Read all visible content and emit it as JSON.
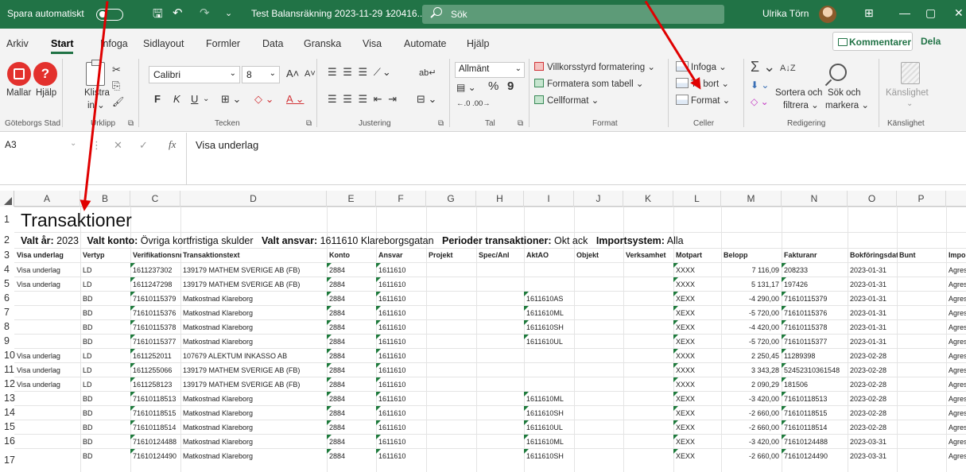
{
  "titlebar": {
    "autosave_label": "Spara automatiskt",
    "toggle_state": "På",
    "document_title": "Test Balansräkning 2023-11-29 120416....",
    "caret": "⌄",
    "search_label": "Sök",
    "user_name": "Ulrika Törn",
    "save_glyph": "🖫",
    "undo_glyph": "↶",
    "redo_glyph": "↷",
    "qat_glyph": "⌄",
    "win_restore_glyph": "⊞",
    "win_min_glyph": "—",
    "win_max_glyph": "▢",
    "win_close_glyph": "✕"
  },
  "tabs": [
    "Arkiv",
    "Start",
    "Infoga",
    "Sidlayout",
    "Formler",
    "Data",
    "Granska",
    "Visa",
    "Automate",
    "Hjälp"
  ],
  "active_tab": "Start",
  "tab_actions": {
    "comments": "Kommentarer",
    "share": "Dela"
  },
  "ribbon": {
    "goteborg": {
      "mallar": "Mallar",
      "hjalp": "Hjälp",
      "label": "Göteborgs Stad"
    },
    "clipboard": {
      "paste_1": "Klistra",
      "paste_2": "in ⌄",
      "label": "Urklipp",
      "cut": "✂",
      "copy": "⎘",
      "brush": "🖌",
      "launcher": "⧉"
    },
    "font": {
      "name": "Calibri",
      "size": "8",
      "grow": "A˄",
      "shrink": "A˅",
      "bold": "F",
      "italic": "K",
      "underline": "U",
      "underline_caret": "⌄",
      "borders": "⊞ ⌄",
      "fill": "◇ ⌄",
      "color": "A ⌄",
      "label": "Tecken",
      "font_caret": "⌄",
      "size_caret": "⌄",
      "launcher": "⧉"
    },
    "alignment": {
      "top_row": "☰ ☰ ☰ ⟋⌄",
      "bottom_row": "☰ ☰ ☰ ⇤ ⇥",
      "wrap": "ab↵",
      "merge": "⊟ ⌄",
      "label": "Justering",
      "launcher": "⧉"
    },
    "number": {
      "format": "Allmänt",
      "format_caret": "⌄",
      "currency": "▤ ⌄",
      "percent": "%",
      "comma": "9",
      "decimals": "←.0 .00→",
      "label": "Tal",
      "launcher": "⧉"
    },
    "styles": {
      "cond": "Villkorsstyrd formatering ⌄",
      "table": "Formatera som tabell ⌄",
      "cell": "Cellformat ⌄",
      "label": "Format"
    },
    "cells": {
      "insert": "Infoga ⌄",
      "delete": "Ta bort ⌄",
      "format": "Format ⌄",
      "label": "Celler"
    },
    "editing": {
      "autosum": "Σ ⌄",
      "fill": "⬇ ⌄",
      "clear": "◇ ⌄",
      "sort_1": "Sortera och",
      "sort_2": "filtrera ⌄",
      "find_1": "Sök och",
      "find_2": "markera ⌄",
      "label": "Redigering",
      "sort_glyph": "A↓Z"
    },
    "sensitivity": {
      "btn": "Känslighet",
      "caret": "⌄",
      "label": "Känslighet"
    }
  },
  "formula_bar": {
    "name_box": "A3",
    "name_caret": "⌄",
    "dots": "⋮",
    "cancel": "✕",
    "enter": "✓",
    "fx": "fx",
    "value": "Visa underlag"
  },
  "columns": [
    "A",
    "B",
    "C",
    "D",
    "E",
    "F",
    "G",
    "H",
    "I",
    "J",
    "K",
    "L",
    "M",
    "N",
    "O",
    "P"
  ],
  "row_numbers": [
    "1",
    "2",
    "3",
    "4",
    "5",
    "6",
    "7",
    "8",
    "9",
    "10",
    "11",
    "12",
    "13",
    "14",
    "15",
    "16",
    "17"
  ],
  "sheet": {
    "title": "Transaktioner",
    "info": [
      {
        "label": "Valt år:",
        "value": "2023"
      },
      {
        "label": "Valt konto:",
        "value": "Övriga kortfristiga skulder"
      },
      {
        "label": "Valt ansvar:",
        "value": "1611610 Klareborgsgatan"
      },
      {
        "label": "Perioder transaktioner:",
        "value": "Okt ack"
      },
      {
        "label": "Importsystem:",
        "value": "Alla"
      }
    ],
    "headers": [
      "Visa underlag",
      "Vertyp",
      "Verifikationsnr",
      "Transaktionstext",
      "Konto",
      "Ansvar",
      "Projekt",
      "Spec/Anl",
      "AktAO",
      "Objekt",
      "Verksamhet",
      "Motpart",
      "Belopp",
      "Fakturanr",
      "Bokföringsdat",
      "Bunt",
      "Impo"
    ],
    "rows": [
      [
        "Visa underlag",
        "LD",
        "1611237302",
        "139179 MATHEM SVERIGE AB (FB)",
        "2884",
        "1611610",
        "",
        "",
        "",
        "",
        "",
        "XXXX",
        "7 116,09",
        "208233",
        "2023-01-31",
        "",
        "Agres"
      ],
      [
        "Visa underlag",
        "LD",
        "1611247298",
        "139179 MATHEM SVERIGE AB (FB)",
        "2884",
        "1611610",
        "",
        "",
        "",
        "",
        "",
        "XXXX",
        "5 131,17",
        "197426",
        "2023-01-31",
        "",
        "Agres"
      ],
      [
        "",
        "BD",
        "71610115379",
        "Matkostnad Klareborg",
        "2884",
        "1611610",
        "",
        "",
        "1611610AS",
        "",
        "",
        "XEXX",
        "-4 290,00",
        "71610115379",
        "2023-01-31",
        "",
        "Agres"
      ],
      [
        "",
        "BD",
        "71610115376",
        "Matkostnad Klareborg",
        "2884",
        "1611610",
        "",
        "",
        "1611610ML",
        "",
        "",
        "XEXX",
        "-5 720,00",
        "71610115376",
        "2023-01-31",
        "",
        "Agres"
      ],
      [
        "",
        "BD",
        "71610115378",
        "Matkostnad Klareborg",
        "2884",
        "1611610",
        "",
        "",
        "1611610SH",
        "",
        "",
        "XEXX",
        "-4 420,00",
        "71610115378",
        "2023-01-31",
        "",
        "Agres"
      ],
      [
        "",
        "BD",
        "71610115377",
        "Matkostnad Klareborg",
        "2884",
        "1611610",
        "",
        "",
        "1611610UL",
        "",
        "",
        "XEXX",
        "-5 720,00",
        "71610115377",
        "2023-01-31",
        "",
        "Agres"
      ],
      [
        "Visa underlag",
        "LD",
        "1611252011",
        "107679 ALEKTUM INKASSO AB",
        "2884",
        "1611610",
        "",
        "",
        "",
        "",
        "",
        "XXXX",
        "2 250,45",
        "11289398",
        "2023-02-28",
        "",
        "Agres"
      ],
      [
        "Visa underlag",
        "LD",
        "1611255066",
        "139179 MATHEM SVERIGE AB (FB)",
        "2884",
        "1611610",
        "",
        "",
        "",
        "",
        "",
        "XXXX",
        "3 343,28",
        "52452310361548",
        "2023-02-28",
        "",
        "Agres"
      ],
      [
        "Visa underlag",
        "LD",
        "1611258123",
        "139179 MATHEM SVERIGE AB (FB)",
        "2884",
        "1611610",
        "",
        "",
        "",
        "",
        "",
        "XXXX",
        "2 090,29",
        "181506",
        "2023-02-28",
        "",
        "Agres"
      ],
      [
        "",
        "BD",
        "71610118513",
        "Matkostnad Klareborg",
        "2884",
        "1611610",
        "",
        "",
        "1611610ML",
        "",
        "",
        "XEXX",
        "-3 420,00",
        "71610118513",
        "2023-02-28",
        "",
        "Agres"
      ],
      [
        "",
        "BD",
        "71610118515",
        "Matkostnad Klareborg",
        "2884",
        "1611610",
        "",
        "",
        "1611610SH",
        "",
        "",
        "XEXX",
        "-2 660,00",
        "71610118515",
        "2023-02-28",
        "",
        "Agres"
      ],
      [
        "",
        "BD",
        "71610118514",
        "Matkostnad Klareborg",
        "2884",
        "1611610",
        "",
        "",
        "1611610UL",
        "",
        "",
        "XEXX",
        "-2 660,00",
        "71610118514",
        "2023-02-28",
        "",
        "Agres"
      ],
      [
        "",
        "BD",
        "71610124488",
        "Matkostnad Klareborg",
        "2884",
        "1611610",
        "",
        "",
        "1611610ML",
        "",
        "",
        "XEXX",
        "-3 420,00",
        "71610124488",
        "2023-03-31",
        "",
        "Agres"
      ],
      [
        "",
        "BD",
        "71610124490",
        "Matkostnad Klareborg",
        "2884",
        "1611610",
        "",
        "",
        "1611610SH",
        "",
        "",
        "XEXX",
        "-2 660,00",
        "71610124490",
        "2023-03-31",
        "",
        "Agres"
      ]
    ]
  },
  "colors": {
    "excel_green": "#217346",
    "annotation_red": "#e00000"
  }
}
